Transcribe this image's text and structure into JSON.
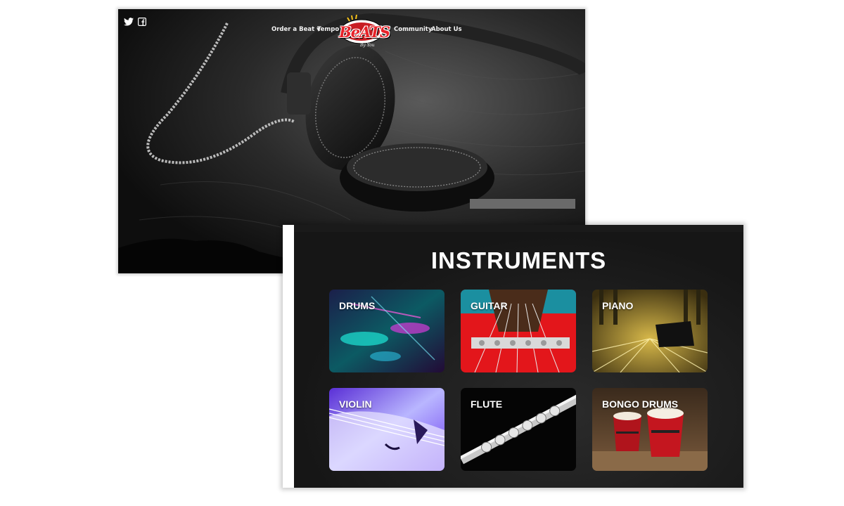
{
  "hero": {
    "social": [
      {
        "name": "twitter-icon"
      },
      {
        "name": "facebook-icon"
      }
    ],
    "nav": {
      "order_a_beat": "Order a Beat",
      "tempo": "Tempo",
      "community": "Community",
      "about_us": "About Us"
    },
    "logo": {
      "text": "BeATS",
      "tagline": "By You"
    }
  },
  "instruments": {
    "title": "INSTRUMENTS",
    "cards": [
      {
        "label": "DRUMS"
      },
      {
        "label": "GUITAR"
      },
      {
        "label": "PIANO"
      },
      {
        "label": "VIOLIN"
      },
      {
        "label": "FLUTE"
      },
      {
        "label": "BONGO DRUMS"
      }
    ]
  },
  "colors": {
    "logo_red": "#e8232a",
    "page_bg": "#ffffff",
    "dark_bg": "#161616"
  }
}
